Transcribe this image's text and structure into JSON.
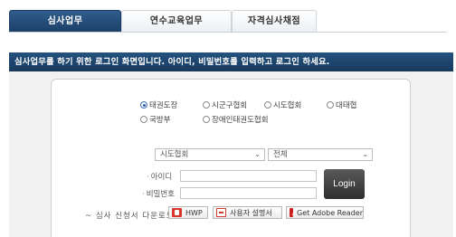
{
  "tabs": [
    {
      "label": "심사업무",
      "active": true
    },
    {
      "label": "연수교육업무",
      "active": false
    },
    {
      "label": "자격심사채점",
      "active": false
    }
  ],
  "notice": "심사업무를 하기 위한 로그인 화면입니다. 아이디, 비밀번호를 입력하고 로그인 하세요.",
  "org_options": [
    {
      "label": "태권도장",
      "checked": true
    },
    {
      "label": "시군구협회",
      "checked": false
    },
    {
      "label": "시도협회",
      "checked": false
    },
    {
      "label": "대태협",
      "checked": false
    },
    {
      "label": "국방부",
      "checked": false
    },
    {
      "label": "장애인태권도협회",
      "checked": false
    }
  ],
  "selects": {
    "region": "시도협회",
    "sub": "전체"
  },
  "form": {
    "id_label": "아이디",
    "id_value": "",
    "pw_label": "비밀번호",
    "pw_value": "",
    "login_label": "Login"
  },
  "downloads": {
    "label": "심사 신청서 다운로드",
    "hwp": "HWP",
    "manual": "사용자 설명서",
    "adobe": "Get Adobe Reader"
  },
  "colors": {
    "tab_active": "#1d3f67",
    "notice_bar": "#1d4670"
  }
}
